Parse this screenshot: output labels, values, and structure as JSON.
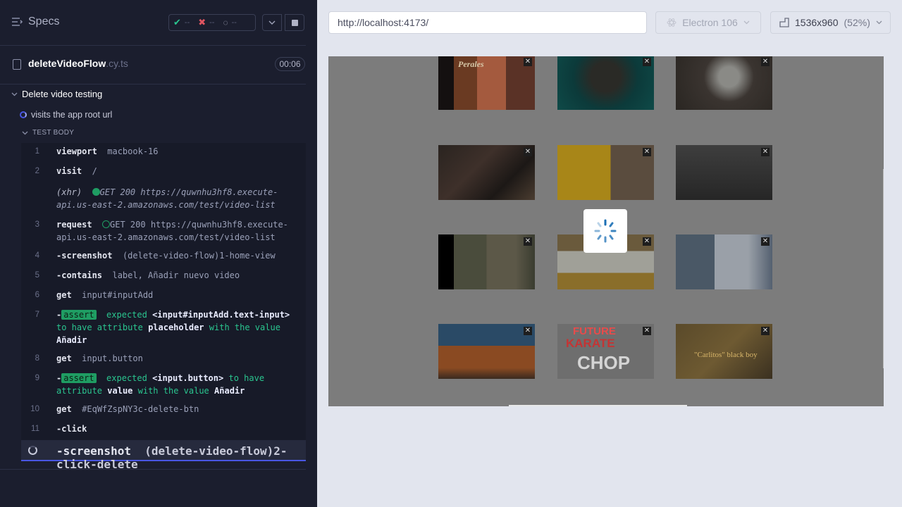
{
  "sidebar": {
    "title": "Specs",
    "stats": {
      "passed": "--",
      "failed": "--",
      "pending": "--"
    },
    "spec": {
      "name": "deleteVideoFlow",
      "ext": ".cy.ts",
      "time": "00:06"
    },
    "suite": "Delete video testing",
    "test": "visits the app root url",
    "test_body_label": "TEST BODY",
    "commands": [
      {
        "n": "1",
        "name": "viewport",
        "msg": "macbook-16"
      },
      {
        "n": "2",
        "name": "visit",
        "msg": "/"
      },
      {
        "n": "",
        "xhr": "(xhr)",
        "msg": "GET 200 https://quwnhu3hf8.execute-api.us-east-2.amazonaws.com/test/video-list"
      },
      {
        "n": "3",
        "name": "request",
        "msg": "GET 200 https://quwnhu3hf8.execute-api.us-east-2.amazonaws.com/test/video-list"
      },
      {
        "n": "4",
        "name": "-screenshot",
        "msg": "(delete-video-flow)1-home-view"
      },
      {
        "n": "5",
        "name": "-contains",
        "msg": "label, Añadir nuevo video"
      },
      {
        "n": "6",
        "name": "get",
        "msg": "input#inputAdd"
      },
      {
        "n": "7",
        "name": "-",
        "badge": "assert",
        "p1": "expected",
        "w1": "<input#inputAdd.text-input>",
        "p2": "to have attribute",
        "w2": "placeholder",
        "p3": "with the value",
        "w3": "Añadir"
      },
      {
        "n": "8",
        "name": "get",
        "msg": "input.button"
      },
      {
        "n": "9",
        "name": "-",
        "badge": "assert",
        "p1": "expected",
        "w1": "<input.button>",
        "p2": "to have attribute",
        "w2": "value",
        "p3": "with the value",
        "w3": "Añadir"
      },
      {
        "n": "10",
        "name": "get",
        "msg": "#EqWfZspNY3c-delete-btn"
      },
      {
        "n": "11",
        "name": "-click",
        "msg": ""
      },
      {
        "n": "",
        "name": "-screenshot",
        "msg": "(delete-video-flow)2-click-delete"
      }
    ]
  },
  "toolbar": {
    "url": "http://localhost:4173/",
    "browser": "Electron 106",
    "viewport": "1536x960",
    "zoom": "(52%)"
  },
  "aut": {
    "captions": [
      "Perales",
      "FUTURE",
      "KARATE",
      "CHOP",
      "\"Carlitos\" black boy"
    ],
    "close_glyph": "✕"
  },
  "colors": {
    "accent": "#4956e3",
    "pass": "#1f9d63",
    "fail": "#e05561"
  }
}
